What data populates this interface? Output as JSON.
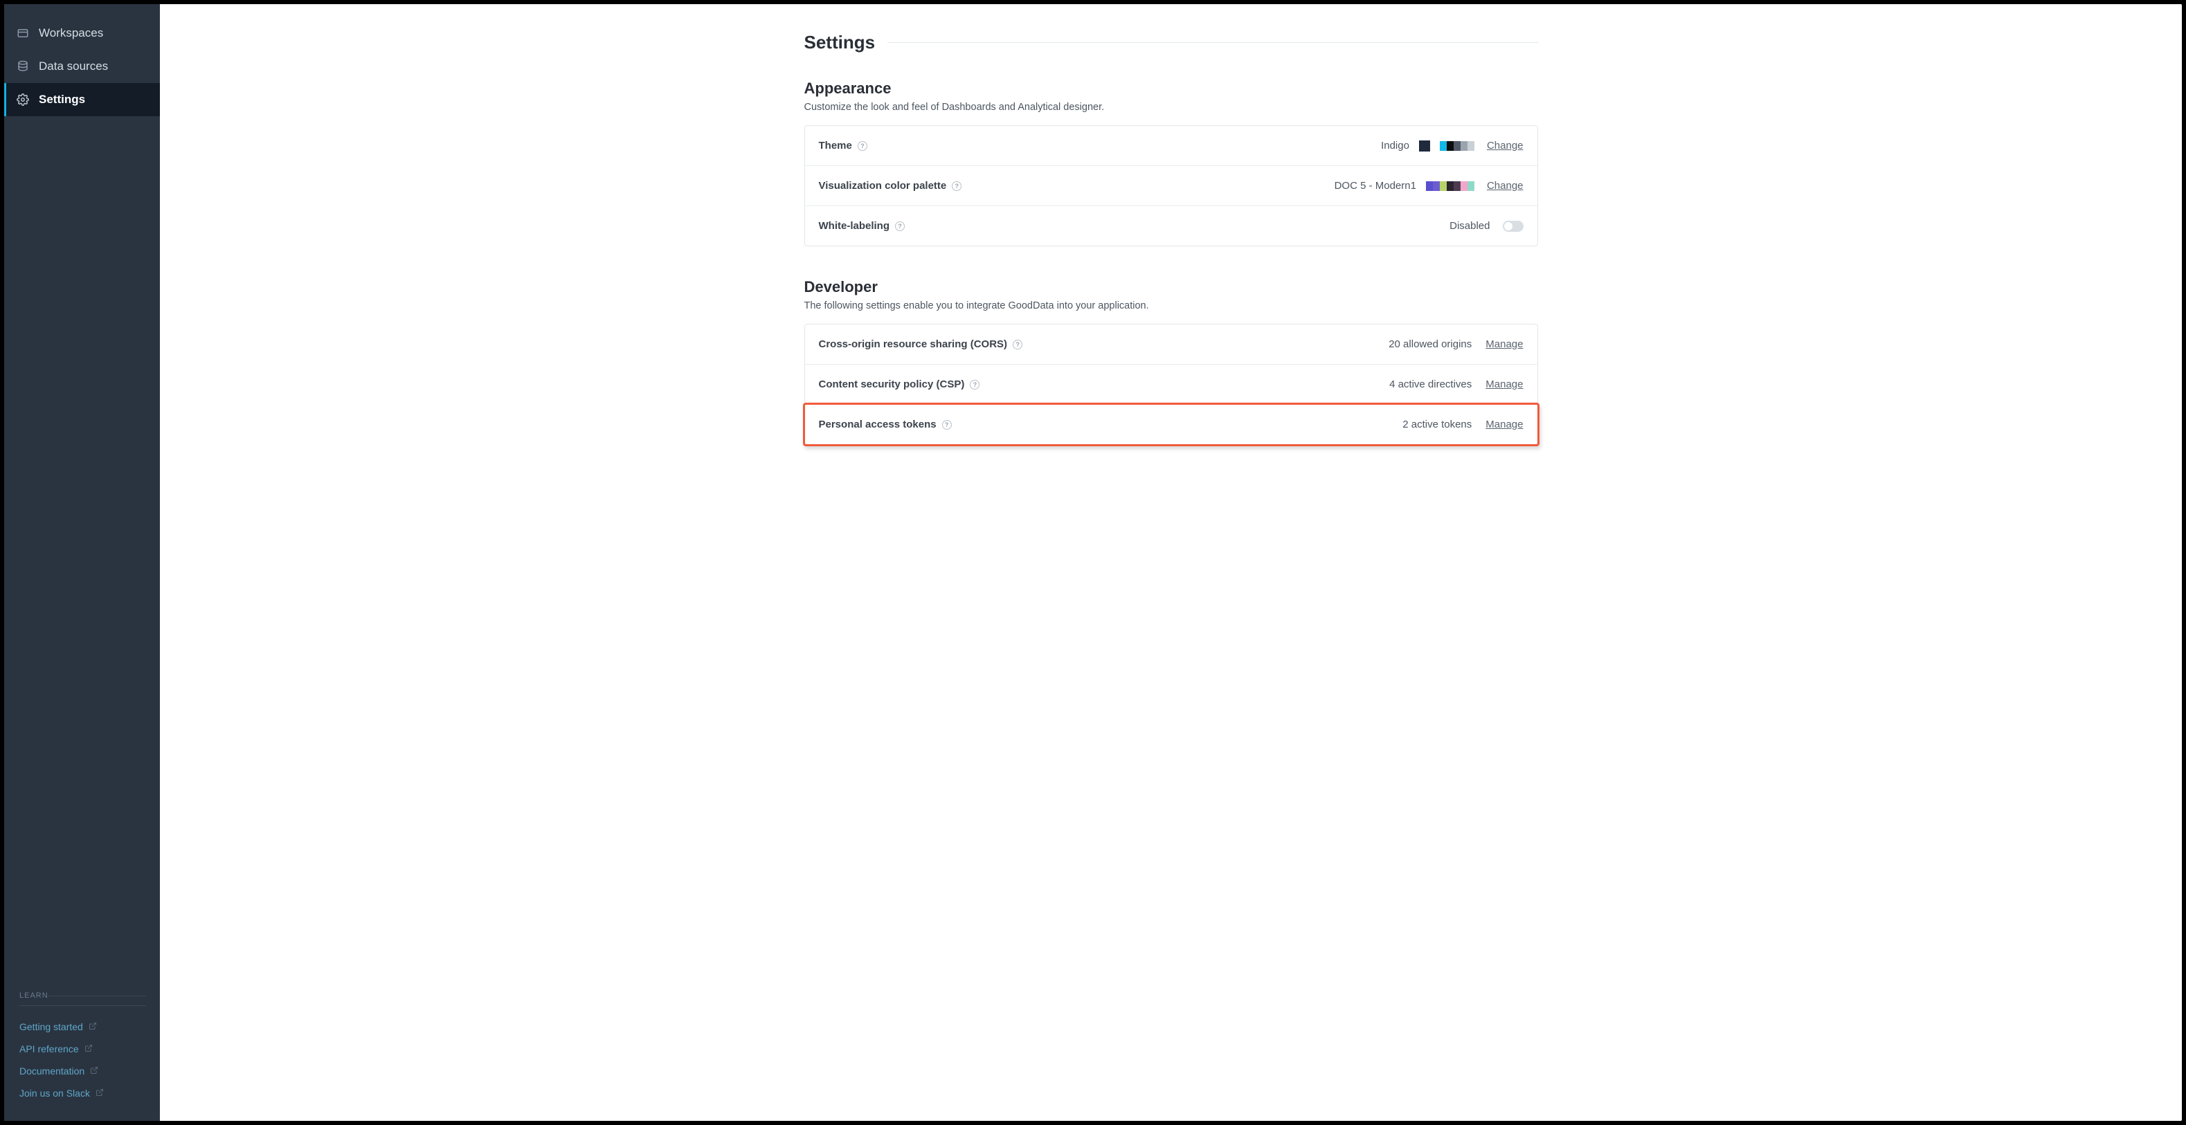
{
  "sidebar": {
    "items": [
      {
        "label": "Workspaces"
      },
      {
        "label": "Data sources"
      },
      {
        "label": "Settings"
      }
    ],
    "learn_header": "LEARN",
    "learn_items": [
      {
        "label": "Getting started"
      },
      {
        "label": "API reference"
      },
      {
        "label": "Documentation"
      },
      {
        "label": "Join us on Slack"
      }
    ]
  },
  "page": {
    "title": "Settings"
  },
  "appearance": {
    "title": "Appearance",
    "desc": "Customize the look and feel of Dashboards and Analytical designer.",
    "theme": {
      "label": "Theme",
      "value": "Indigo",
      "action": "Change",
      "swatch_primary": "#1f2a3d",
      "strip": [
        "#12b8e6",
        "#0d0d0d",
        "#4f5a66",
        "#9aa4ae"
      ]
    },
    "palette": {
      "label": "Visualization color palette",
      "value": "DOC 5 - Modern1",
      "action": "Change",
      "strip": [
        "#5a4fcf",
        "#6d5bd0",
        "#b8d26a",
        "#2a2330",
        "#f3a6cc",
        "#8fd9c8"
      ]
    },
    "whitelabel": {
      "label": "White-labeling",
      "status": "Disabled"
    }
  },
  "developer": {
    "title": "Developer",
    "desc": "The following settings enable you to integrate GoodData into your application.",
    "cors": {
      "label": "Cross-origin resource sharing (CORS)",
      "value": "20 allowed origins",
      "action": "Manage"
    },
    "csp": {
      "label": "Content security policy (CSP)",
      "value": "4 active directives",
      "action": "Manage"
    },
    "tokens": {
      "label": "Personal access tokens",
      "value": "2 active tokens",
      "action": "Manage"
    }
  }
}
